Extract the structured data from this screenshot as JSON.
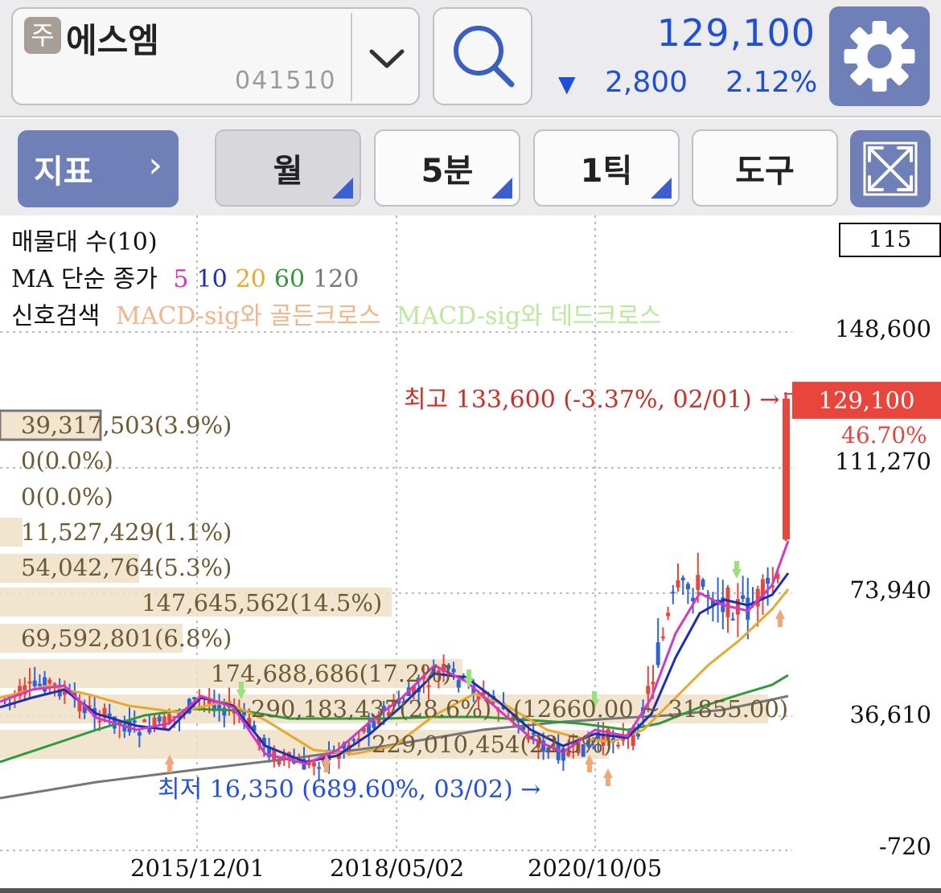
{
  "header": {
    "badge": "주",
    "stock_name": "에스엠",
    "stock_code": "041510",
    "price": "129,100",
    "change_arrow": "▼",
    "change_value": "2,800",
    "change_percent": "2.12%",
    "price_color": "#1f4fd8"
  },
  "icons": {
    "dropdown": "chevron-down-icon",
    "search": "search-icon",
    "settings": "gear-icon",
    "expand": "expand-icon"
  },
  "toolbar": {
    "indicator_label": "지표",
    "period_month": "월",
    "period_5min": "5분",
    "period_1tick": "1틱",
    "tools_label": "도구"
  },
  "legend": {
    "volume_profile": "매물대 수(10)",
    "ma_prefix": "MA 단순 종가",
    "ma_periods": [
      {
        "label": "5",
        "color": "#d437c4"
      },
      {
        "label": "10",
        "color": "#1e2fb0"
      },
      {
        "label": "20",
        "color": "#e8a830"
      },
      {
        "label": "60",
        "color": "#2e9a3a"
      },
      {
        "label": "120",
        "color": "#777777"
      }
    ],
    "signal_prefix": "신호검색",
    "signal_golden": "MACD-sig와 골든크로스",
    "signal_dead": "MACD-sig와 데드크로스"
  },
  "volume_profile": [
    "39,317,503(3.9%)",
    "0(0.0%)",
    "0(0.0%)",
    "11,527,429(1.1%)",
    "54,042,764(5.3%)",
    "147,645,562(14.5%)",
    "69,592,801(6.8%)",
    "174,688,686(17.2%)",
    "290,183,437(28.6%)",
    "229,010,454(22.5%)"
  ],
  "range_label": "(12660.00 ~ 31855.00)",
  "count_box": "115",
  "high_label": "최고 133,600 (-3.37%, 02/01) →",
  "low_label": "최저 16,350 (689.60%, 03/02) →",
  "current_price_tag": "129,100",
  "current_percent": "46.70%",
  "chart_data": {
    "type": "candlestick",
    "y_ticks": [
      "148,600",
      "111,270",
      "73,940",
      "36,610",
      "-720"
    ],
    "x_ticks": [
      "2015/12/01",
      "2018/05/02",
      "2020/10/05"
    ],
    "ylim": [
      -720,
      148600
    ],
    "up_color": "#e8463c",
    "down_color": "#2f64d8",
    "high": 133600,
    "low": 16350,
    "last": 129100
  }
}
